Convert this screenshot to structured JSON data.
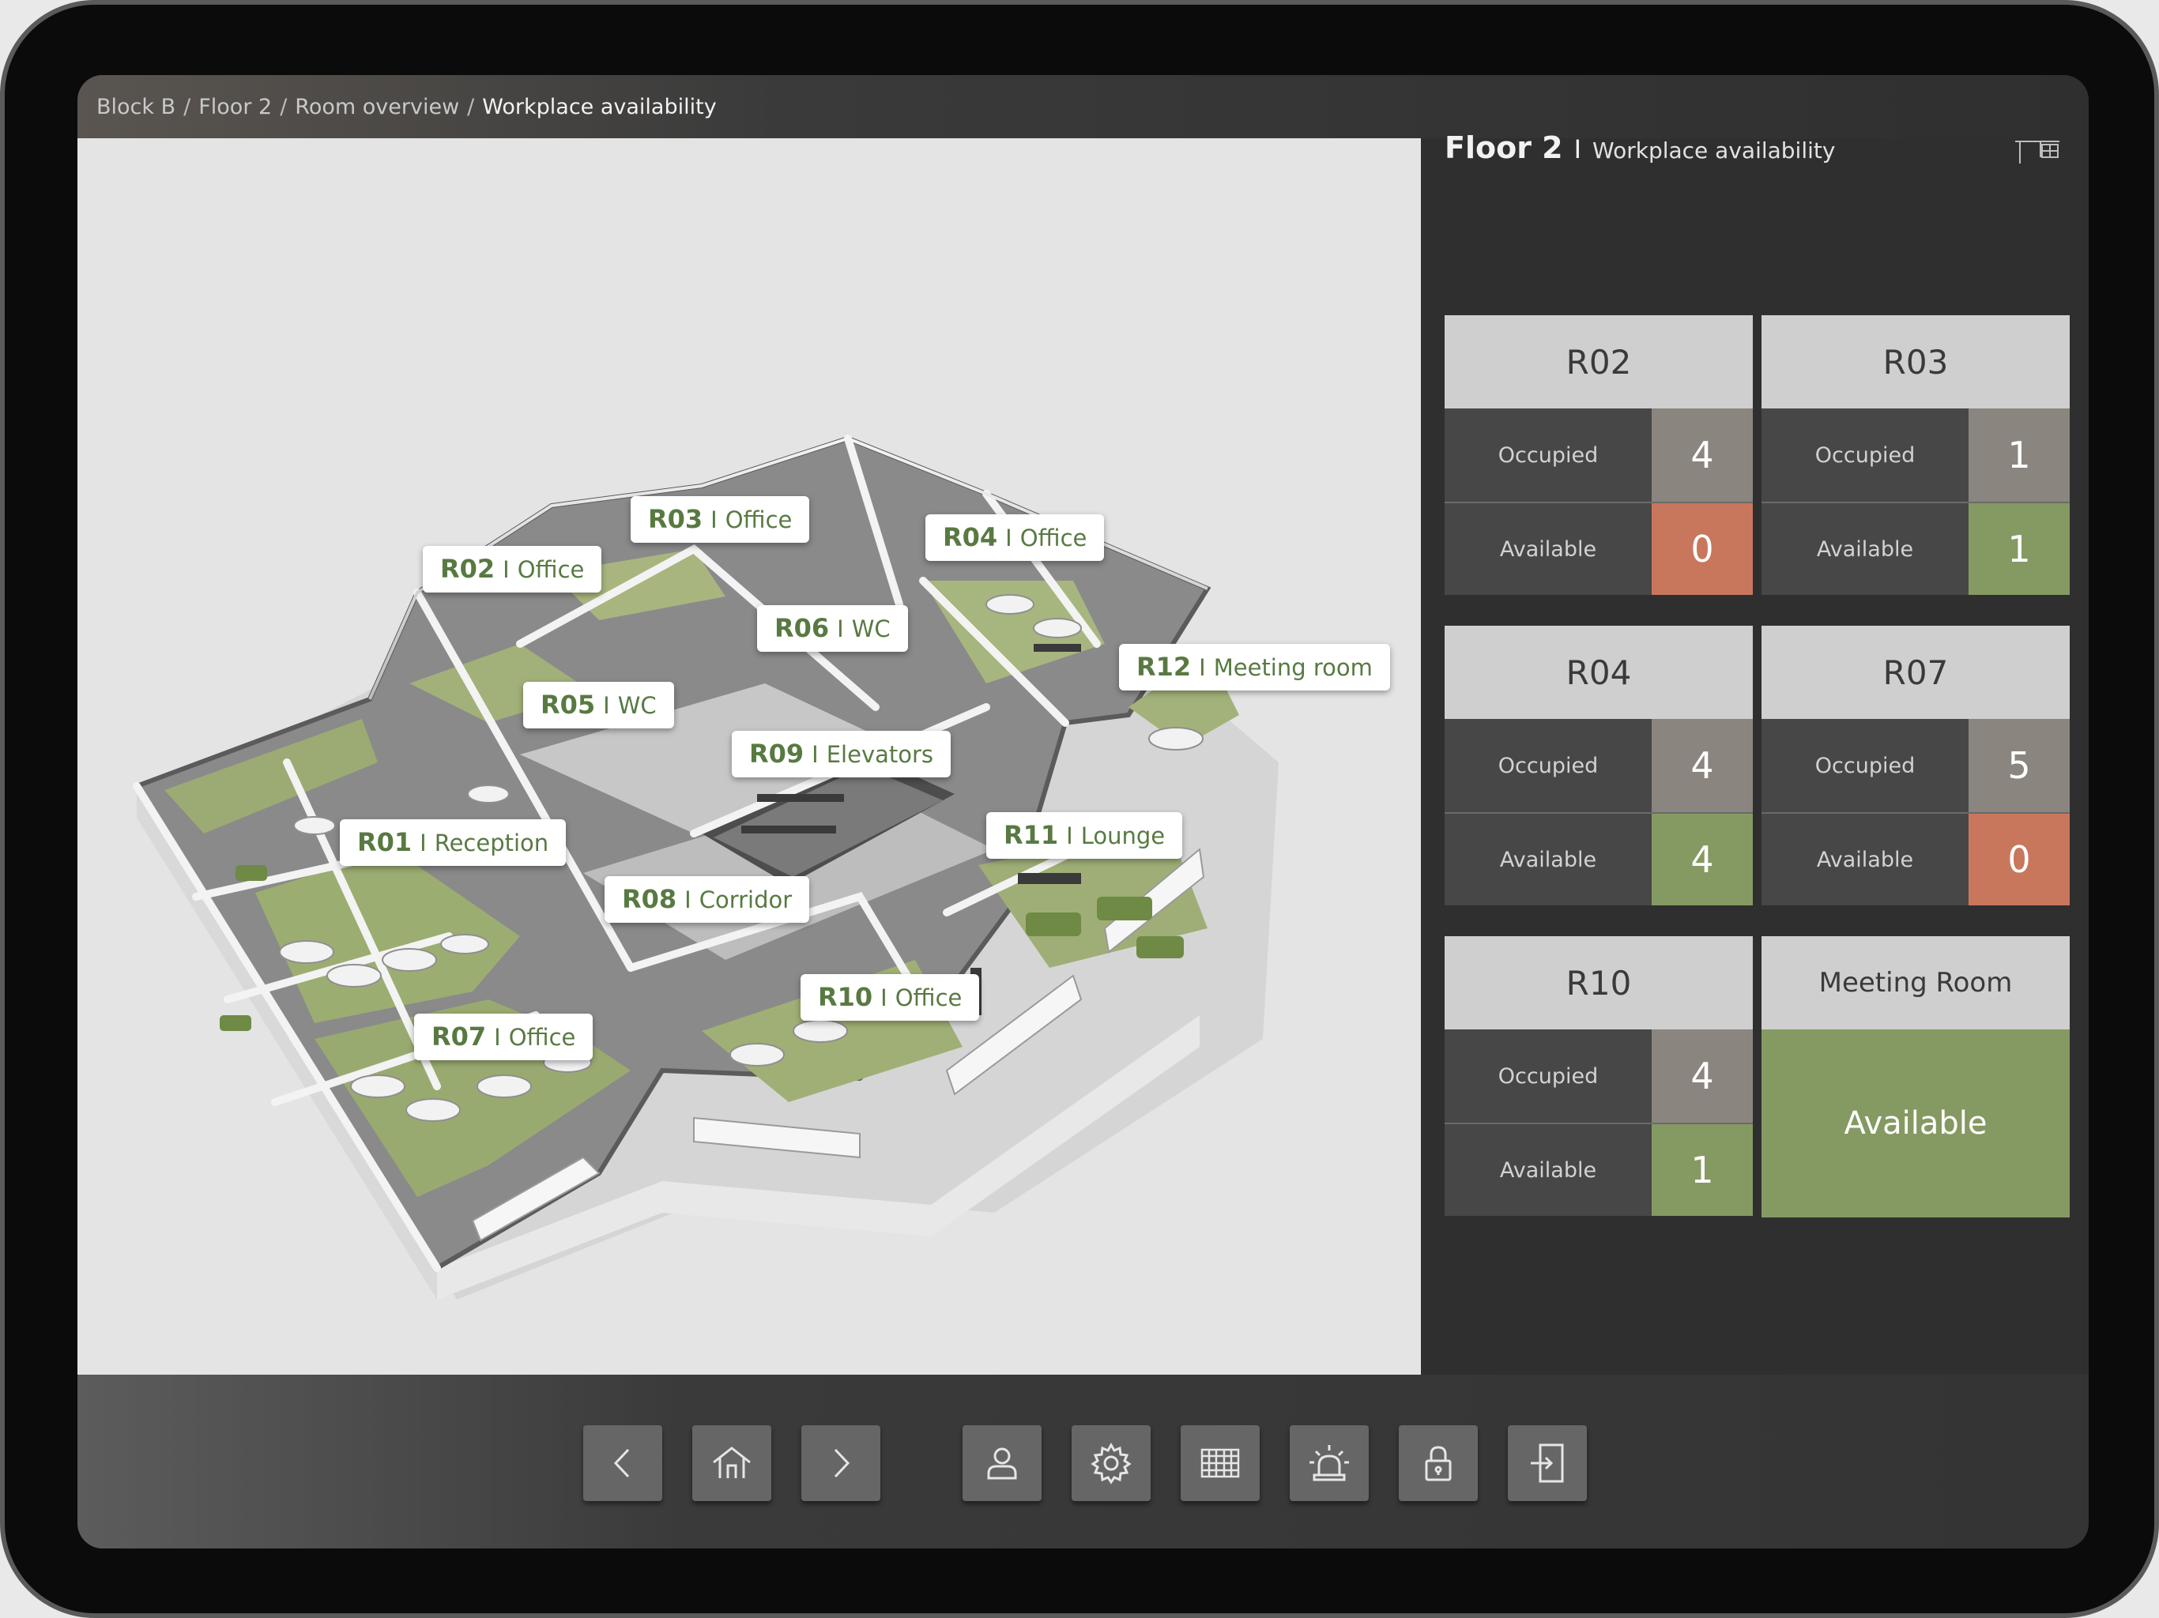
{
  "breadcrumb": [
    {
      "label": "Block B"
    },
    {
      "label": "Floor 2"
    },
    {
      "label": "Room overview"
    },
    {
      "label": "Workplace availability"
    }
  ],
  "panel": {
    "floor": "Floor 2",
    "separator": "I",
    "subtitle": "Workplace availability",
    "icon": "floorplan-icon"
  },
  "rooms": [
    {
      "code": "R01",
      "sep": "I",
      "name": "Reception"
    },
    {
      "code": "R02",
      "sep": "I",
      "name": "Office"
    },
    {
      "code": "R03",
      "sep": "I",
      "name": "Office"
    },
    {
      "code": "R04",
      "sep": "I",
      "name": "Office"
    },
    {
      "code": "R05",
      "sep": "I",
      "name": "WC"
    },
    {
      "code": "R06",
      "sep": "I",
      "name": "WC"
    },
    {
      "code": "R07",
      "sep": "I",
      "name": "Office"
    },
    {
      "code": "R08",
      "sep": "I",
      "name": "Corridor"
    },
    {
      "code": "R09",
      "sep": "I",
      "name": "Elevators"
    },
    {
      "code": "R10",
      "sep": "I",
      "name": "Office"
    },
    {
      "code": "R11",
      "sep": "I",
      "name": "Lounge"
    },
    {
      "code": "R12",
      "sep": "I",
      "name": "Meeting room"
    }
  ],
  "cards": [
    {
      "title": "R02",
      "occupied_label": "Occupied",
      "occupied": "4",
      "available_label": "Available",
      "available": "0",
      "available_color": "#c9775c"
    },
    {
      "title": "R03",
      "occupied_label": "Occupied",
      "occupied": "1",
      "available_label": "Available",
      "available": "1",
      "available_color": "#859a62"
    },
    {
      "title": "R04",
      "occupied_label": "Occupied",
      "occupied": "4",
      "available_label": "Available",
      "available": "4",
      "available_color": "#859a62"
    },
    {
      "title": "R07",
      "occupied_label": "Occupied",
      "occupied": "5",
      "available_label": "Available",
      "available": "0",
      "available_color": "#c9775c"
    },
    {
      "title": "R10",
      "occupied_label": "Occupied",
      "occupied": "4",
      "available_label": "Available",
      "available": "1",
      "available_color": "#859a62"
    }
  ],
  "meeting_card": {
    "title": "Meeting Room",
    "status": "Available",
    "status_color": "#859a62"
  },
  "colors": {
    "occupied": "#8b8580",
    "available_green": "#859a62",
    "available_red": "#c9775c",
    "room_text": "#587a42"
  },
  "toolbar": [
    {
      "icon": "chevron-left-icon"
    },
    {
      "icon": "home-icon"
    },
    {
      "icon": "chevron-right-icon"
    },
    {
      "icon": "user-icon"
    },
    {
      "icon": "gear-icon"
    },
    {
      "icon": "grid-icon"
    },
    {
      "icon": "alarm-icon"
    },
    {
      "icon": "lock-icon"
    },
    {
      "icon": "logout-icon"
    }
  ]
}
